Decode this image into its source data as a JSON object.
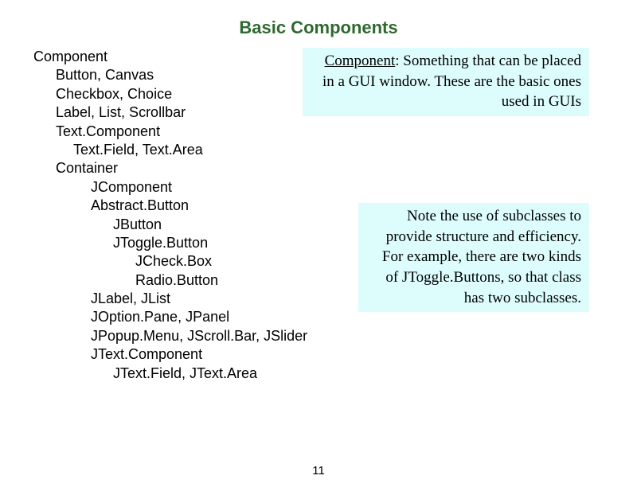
{
  "title": "Basic Components",
  "hierarchy": {
    "r0": "Component",
    "r1": "Button, Canvas",
    "r2": "Checkbox,  Choice",
    "r3": "Label,  List,  Scrollbar",
    "r4": "Text.Component",
    "r5": "Text.Field, Text.Area",
    "r6": "Container",
    "r7": "JComponent",
    "r8": "Abstract.Button",
    "r9": "JButton",
    "r10": "JToggle.Button",
    "r11": "JCheck.Box",
    "r12": "Radio.Button",
    "r13": "JLabel,  JList",
    "r14": "JOption.Pane,  JPanel",
    "r15": "JPopup.Menu,  JScroll.Bar, JSlider",
    "r16": "JText.Component",
    "r17": "JText.Field, JText.Area"
  },
  "box1": {
    "word": "Component",
    "rest": ": Something that can be placed in a GUI window.  These are the basic ones used in GUIs"
  },
  "box2": "Note the use of subclasses to provide structure and efficiency. For example, there are two kinds of JToggle.Buttons, so that class has two subclasses.",
  "page": "11"
}
